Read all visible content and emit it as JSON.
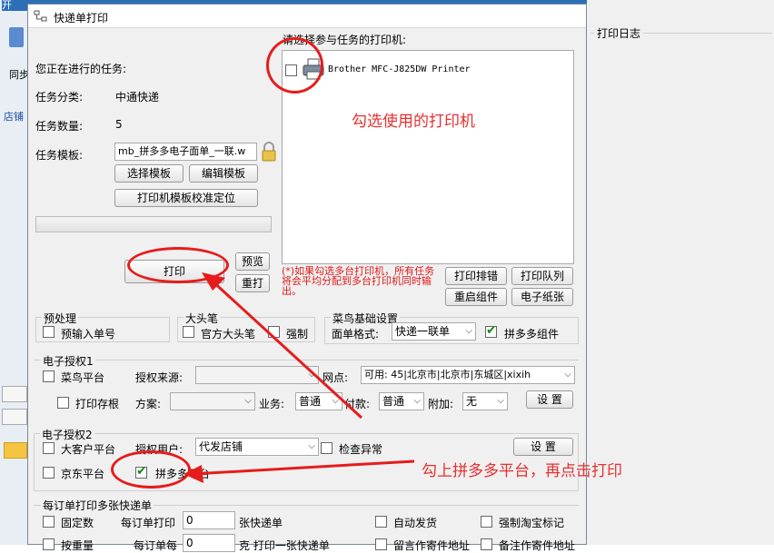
{
  "background_app": {
    "tab_label": "开",
    "sync_label": "同步",
    "store_label": "店铺"
  },
  "dialog": {
    "title": "快递单打印",
    "current_task_label": "您正在进行的任务:",
    "task_category_label": "任务分类:",
    "task_category_value": "中通快递",
    "task_count_label": "任务数量:",
    "task_count_value": "5",
    "task_template_label": "任务模板:",
    "task_template_value": "mb_拼多多电子面单_一联.w",
    "select_template": "选择模板",
    "edit_template": "编辑模板",
    "calibrate_position": "打印机模板校准定位",
    "print": "打印",
    "preview": "预览",
    "reprint": "重打",
    "printer_prompt": "请选择参与任务的打印机:",
    "printers": [
      "Brother MFC-J825DW Printer"
    ],
    "printer_note": "(*)如果勾选多台打印机，所有任务将会平均分配到多台打印机同时输出。",
    "print_queue_order": "打印排错",
    "print_queue": "打印队列",
    "restart_component": "重启组件",
    "e_paper": "电子纸张",
    "print_log_title": "打印日志"
  },
  "preprocess": {
    "title": "预处理",
    "pre_input_number": "预输入单号"
  },
  "big_pen": {
    "title": "大头笔",
    "official_big_pen": "官方大头笔",
    "force": "强制"
  },
  "cainiao": {
    "title": "菜鸟基础设置",
    "sheet_format_label": "面单格式:",
    "sheet_format_value": "快递一联单",
    "pdd_component": "拼多多组件"
  },
  "auth1": {
    "title": "电子授权1",
    "cainiao_platform": "菜鸟平台",
    "auth_source_label": "授权来源:",
    "outlet_label": "网点:",
    "outlet_value": "可用: 45|北京市|北京市|东城区|xixih",
    "print_stub": "打印存根",
    "plan_label": "方案:",
    "business_label": "业务:",
    "business_value": "普通",
    "payment_label": "付款:",
    "payment_value": "普通",
    "addon_label": "附加:",
    "addon_value": "无",
    "settings": "设 置"
  },
  "auth2": {
    "title": "电子授权2",
    "big_customer_platform": "大客户平台",
    "auth_user_label": "授权用户:",
    "auth_user_value": "代发店铺",
    "check_exception": "检查异常",
    "settings": "设 置",
    "jd_platform": "京东平台",
    "pdd_platform": "拼多多平台"
  },
  "multi": {
    "title": "每订单打印多张快递单",
    "fixed_count": "固定数",
    "per_order_print": "每订单打印",
    "per_order_value": "0",
    "sheets_unit": "张快递单",
    "auto_ship": "自动发货",
    "force_taobao_mark": "强制淘宝标记",
    "by_weight": "按重量",
    "per_order_weight_label": "每订单每",
    "per_order_weight_value": "0",
    "weight_unit": "克 打印一张快递单",
    "keep_sender_addr": "留言作寄件地址",
    "remark_sender_addr": "备注作寄件地址"
  },
  "annotations": {
    "check_printer": "勾选使用的打印机",
    "check_pdd": "勾上拼多多平台，再点击打印"
  },
  "colors": {
    "annotation_red": "#e61c1c",
    "checked_green": "#1a8a1a"
  }
}
